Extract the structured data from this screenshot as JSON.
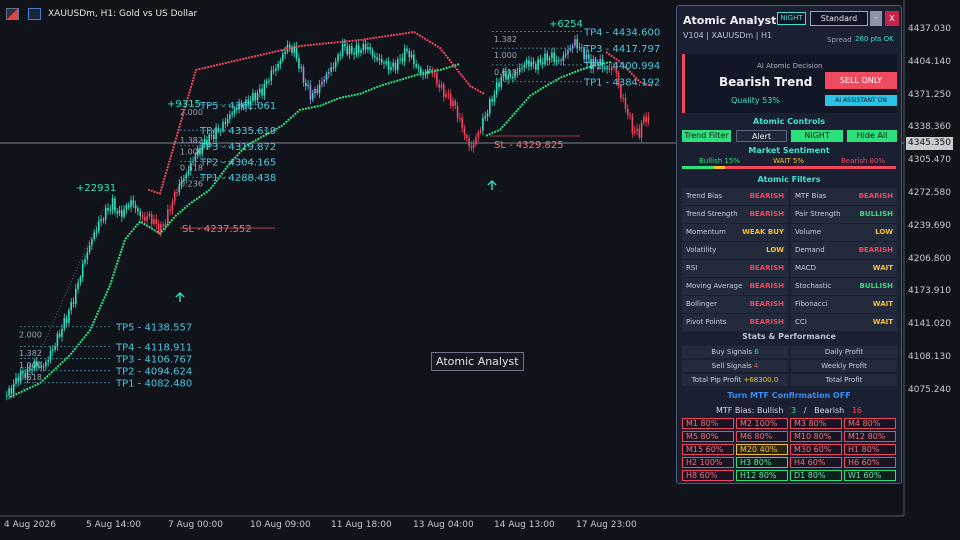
{
  "chart": {
    "title": "XAUUSDm, H1:  Gold vs US Dollar",
    "price_axis": [
      "4437.030",
      "4404.140",
      "4371.250",
      "4338.360",
      "4305.470",
      "4272.580",
      "4239.690",
      "4206.800",
      "4173.910",
      "4141.020",
      "4108.130",
      "4075.240"
    ],
    "current_price": "4345.350",
    "time_axis": [
      "4 Aug 2026",
      "5 Aug 14:00",
      "7 Aug 00:00",
      "10 Aug 09:00",
      "11 Aug 18:00",
      "13 Aug 04:00",
      "14 Aug 13:00",
      "17 Aug 23:00"
    ],
    "watermark": "Atomic Analyst",
    "annotations": {
      "pip1": "+22931",
      "pip2": "+9315",
      "pip3": "+6254",
      "tp_group1": [
        "TP5 - 4138.557",
        "TP4 - 4118.911",
        "TP3 - 4106.767",
        "TP2 - 4094.624",
        "TP1 - 4082.480"
      ],
      "fib_group1": [
        "2.000",
        "1.382",
        "1.000",
        "0.618"
      ],
      "tp_group2": [
        "TP5 - 4361.061",
        "TP4 - 4335.619",
        "TP3 - 4319.872",
        "TP2 - 4304.165",
        "TP1 - 4288.438"
      ],
      "fib_group2": [
        "2.000",
        "1.382",
        "1.000",
        "0.618",
        "0.236"
      ],
      "sl2": "SL - 4237.552",
      "tp_group3": [
        "TP4 - 4434.600",
        "TP3 - 4417.797",
        "TP2 - 4400.994",
        "TP1 - 4384.192"
      ],
      "fib_group3": [
        "1.382",
        "1.000",
        "0.618"
      ],
      "sl3": "SL - 4329.825"
    },
    "colors": {
      "bull": "#35e0c0",
      "bear": "#f04660",
      "neutral": "#a98ae8",
      "trail": "#2ee07c"
    }
  },
  "panel": {
    "title": "Atomic Analyst",
    "night_btn": "NIGHT",
    "standard_btn": "Standard",
    "min_btn": "-",
    "close_btn": "X",
    "version": "V104 | XAUUSDm | H1",
    "spread_label": "Spread",
    "spread_value": "260 pts OK",
    "decision_label": "AI Atomic Decision",
    "decision": "Bearish Trend",
    "quality": "Quality 53%",
    "sell_btn": "SELL ONLY",
    "ai_btn": "AI ASSISTANT ON",
    "controls_title": "Atomic Controls",
    "controls": [
      "Trend Filter",
      "Alert",
      "NIGHT",
      "Hide All"
    ],
    "sentiment_title": "Market Sentiment",
    "sentiment": {
      "bullish": "Bullish 15%",
      "wait": "WAIT 5%",
      "bearish": "Bearish 80%",
      "bull_pct": 15,
      "wait_pct": 5,
      "bear_pct": 80
    },
    "filters_title": "Atomic Filters",
    "filters": [
      {
        "label": "Trend Bias",
        "value": "BEARISH",
        "state": "bear"
      },
      {
        "label": "MTF Bias",
        "value": "BEARISH",
        "state": "bear"
      },
      {
        "label": "Trend Strength",
        "value": "BEARISH",
        "state": "bear"
      },
      {
        "label": "Pair Strength",
        "value": "BULLISH",
        "state": "bull"
      },
      {
        "label": "Momentum",
        "value": "WEAK BUY",
        "state": "wait"
      },
      {
        "label": "Volume",
        "value": "LOW",
        "state": "wait"
      },
      {
        "label": "Volatility",
        "value": "LOW",
        "state": "wait"
      },
      {
        "label": "Demand",
        "value": "BEARISH",
        "state": "bear"
      },
      {
        "label": "RSI",
        "value": "BEARISH",
        "state": "bear"
      },
      {
        "label": "MACD",
        "value": "WAIT",
        "state": "wait"
      },
      {
        "label": "Moving Average",
        "value": "BEARISH",
        "state": "bear"
      },
      {
        "label": "Stochastic",
        "value": "BULLISH",
        "state": "bull"
      },
      {
        "label": "Bollinger",
        "value": "BEARISH",
        "state": "bear"
      },
      {
        "label": "Fibonacci",
        "value": "WAIT",
        "state": "wait"
      },
      {
        "label": "Pivot Points",
        "value": "BEARISH",
        "state": "bear"
      },
      {
        "label": "CCI",
        "value": "WAIT",
        "state": "wait"
      }
    ],
    "stats_title": "Stats & Performance",
    "stats": {
      "buy_label": "Buy Signals",
      "buy_value": "6",
      "sell_label": "Sell Signals",
      "sell_value": "4",
      "pip_label": "Total Pip Profit",
      "pip_value": "+68300.0",
      "daily": "Daily Profit",
      "weekly": "Weekly Profit",
      "total": "Total Profit"
    },
    "mtf_toggle": "Turn MTF Confirmation OFF",
    "mtf_bias": {
      "label": "MTF Bias:",
      "bull_label": "Bullish",
      "bull_count": "3",
      "sep": "/",
      "bear_label": "Bearish",
      "bear_count": "16"
    },
    "tf": [
      {
        "label": "M1  80%",
        "state": "bear"
      },
      {
        "label": "M2  100%",
        "state": "bear"
      },
      {
        "label": "M3  80%",
        "state": "bear"
      },
      {
        "label": "M4  80%",
        "state": "bear"
      },
      {
        "label": "M5  80%",
        "state": "bear"
      },
      {
        "label": "M6  80%",
        "state": "bear"
      },
      {
        "label": "M10  80%",
        "state": "bear"
      },
      {
        "label": "M12  80%",
        "state": "bear"
      },
      {
        "label": "M15  60%",
        "state": "bear"
      },
      {
        "label": "M20  40%",
        "state": "wait"
      },
      {
        "label": "M30  60%",
        "state": "bear"
      },
      {
        "label": "H1  80%",
        "state": "bear"
      },
      {
        "label": "H2  100%",
        "state": "bear"
      },
      {
        "label": "H3  80%",
        "state": "bull"
      },
      {
        "label": "H4  60%",
        "state": "bear"
      },
      {
        "label": "H6  60%",
        "state": "bear"
      },
      {
        "label": "H8  60%",
        "state": "bear"
      },
      {
        "label": "H12  80%",
        "state": "bull"
      },
      {
        "label": "D1  80%",
        "state": "bull"
      },
      {
        "label": "W1  60%",
        "state": "bull"
      }
    ]
  }
}
